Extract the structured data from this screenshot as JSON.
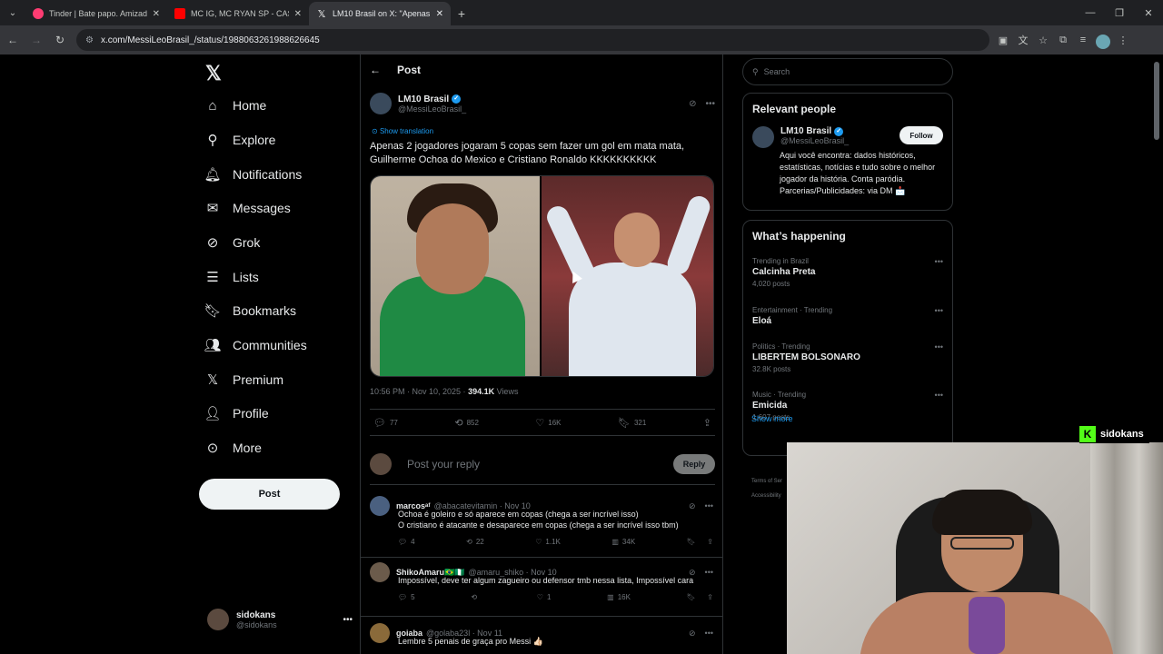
{
  "browser": {
    "tabs": [
      {
        "title": "Tinder | Bate papo. Amizade. En",
        "favicon_color": "#fe3c72"
      },
      {
        "title": "MC IG, MC RYAN SP - CASA",
        "favicon_color": "#ff0000"
      },
      {
        "title": "LM10 Brasil on X: \"Apenas 2 jog",
        "favicon_color": "#000000"
      }
    ],
    "url": "x.com/MessiLeoBrasil_/status/1988063261988626645"
  },
  "nav": {
    "items": [
      {
        "label": "Home",
        "icon": "home-icon"
      },
      {
        "label": "Explore",
        "icon": "search-icon"
      },
      {
        "label": "Notifications",
        "icon": "bell-icon"
      },
      {
        "label": "Messages",
        "icon": "envelope-icon"
      },
      {
        "label": "Grok",
        "icon": "grok-icon"
      },
      {
        "label": "Lists",
        "icon": "list-icon"
      },
      {
        "label": "Bookmarks",
        "icon": "bookmark-icon"
      },
      {
        "label": "Communities",
        "icon": "people-icon"
      },
      {
        "label": "Premium",
        "icon": "x-icon"
      },
      {
        "label": "Profile",
        "icon": "person-icon"
      },
      {
        "label": "More",
        "icon": "more-circle-icon"
      }
    ],
    "post_label": "Post",
    "account": {
      "name": "sidokans",
      "handle": "@sidokans"
    }
  },
  "post": {
    "header": "Post",
    "author_name": "LM10 Brasil",
    "author_handle": "@MessiLeoBrasil_",
    "show_translation": "Show translation",
    "text": "Apenas 2 jogadores jogaram 5 copas sem fazer um gol em mata mata, Guilherme Ochoa do Mexico e Cristiano Ronaldo KKKKKKKKKK",
    "time": "10:56 PM · Nov 10, 2025 · ",
    "views": "394.1K",
    "views_label": " Views",
    "replies": "77",
    "reposts": "852",
    "likes": "16K",
    "bookmarks": "321",
    "reply_placeholder": "Post your reply",
    "reply_button": "Reply"
  },
  "replies": [
    {
      "name": "marcosᵃᶠ",
      "handle": "@abacatevitamin · Nov 10",
      "lines": [
        "Ochoa é goleiro e só aparece em copas (chega a ser incrível isso)",
        "O cristiano é atacante e desaparece em copas (chega a ser incrível isso tbm)"
      ],
      "replies": "4",
      "reposts": "22",
      "likes": "1.1K",
      "views": "34K"
    },
    {
      "name": "ShikoAmaru🇧🇷🇳🇬",
      "handle": "@amaru_shiko · Nov 10",
      "lines": [
        "Impossível, deve ter algum zagueiro ou defensor tmb nessa lista, Impossível cara"
      ],
      "replies": "5",
      "reposts": "",
      "likes": "1",
      "views": "16K"
    },
    {
      "name": "goiaba",
      "handle": "@golaba23l · Nov 11",
      "lines": [
        "Lembre 5 penais de graça pro Messi 👍🏻"
      ]
    }
  ],
  "sidebar": {
    "search_placeholder": "Search",
    "relevant_title": "Relevant people",
    "rp_name": "LM10 Brasil",
    "rp_handle": "@MessiLeoBrasil_",
    "follow": "Follow",
    "rp_bio": "Aqui você encontra: dados históricos, estatísticas, notícias e tudo sobre o melhor jogador da história. Conta paródia. Parcerias/Publicidades: via DM 📩",
    "happening_title": "What’s happening",
    "trends": [
      {
        "cat": "Trending in Brazil",
        "name": "Calcinha Preta",
        "count": "4,020 posts"
      },
      {
        "cat": "Entertainment · Trending",
        "name": "Eloá",
        "count": ""
      },
      {
        "cat": "Politics · Trending",
        "name": "LIBERTEM BOLSONARO",
        "count": "32.8K posts"
      },
      {
        "cat": "Music · Trending",
        "name": "Emicida",
        "count": "1,607 posts"
      }
    ],
    "show_more": "Show more",
    "footer1": "Terms of Ser",
    "footer2": "Accessibility"
  },
  "streamer": "sidokans"
}
